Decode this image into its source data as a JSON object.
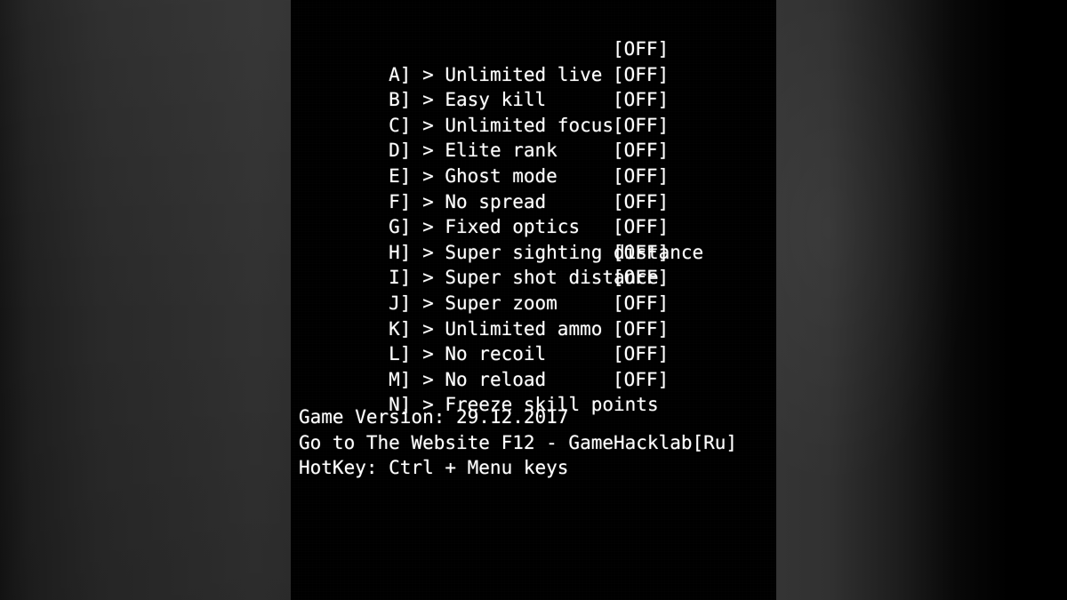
{
  "panel": {
    "background_color": "#000000",
    "text_color": "#ffffff",
    "menu": [
      {
        "key": "A]",
        "arrow": ">",
        "label": "Unlimited live",
        "state": "[OFF]"
      },
      {
        "key": "B]",
        "arrow": ">",
        "label": "Easy kill",
        "state": "[OFF]"
      },
      {
        "key": "C]",
        "arrow": ">",
        "label": "Unlimited focus",
        "state": "[OFF]"
      },
      {
        "key": "D]",
        "arrow": ">",
        "label": "Elite rank",
        "state": "[OFF]"
      },
      {
        "key": "E]",
        "arrow": ">",
        "label": "Ghost mode",
        "state": "[OFF]"
      },
      {
        "key": "F]",
        "arrow": ">",
        "label": "No spread",
        "state": "[OFF]"
      },
      {
        "key": "G]",
        "arrow": ">",
        "label": "Fixed optics",
        "state": "[OFF]"
      },
      {
        "key": "H]",
        "arrow": ">",
        "label": "Super sighting distance",
        "state": "[OFF]"
      },
      {
        "key": "I]",
        "arrow": ">",
        "label": "Super shot distance",
        "state": "[OFF]"
      },
      {
        "key": "J]",
        "arrow": ">",
        "label": "Super zoom",
        "state": "[OFF]"
      },
      {
        "key": "K]",
        "arrow": ">",
        "label": "Unlimited ammo",
        "state": "[OFF]"
      },
      {
        "key": "L]",
        "arrow": ">",
        "label": "No recoil",
        "state": "[OFF]"
      },
      {
        "key": "M]",
        "arrow": ">",
        "label": "No reload",
        "state": "[OFF]"
      },
      {
        "key": "N]",
        "arrow": ">",
        "label": "Freeze skill points",
        "state": "[OFF]"
      }
    ],
    "footer": {
      "game_version": "Game Version: 29.12.2017",
      "website": "Go to The Website F12 - GameHacklab[Ru]",
      "hotkey": "HotKey: Ctrl + Menu keys"
    }
  }
}
